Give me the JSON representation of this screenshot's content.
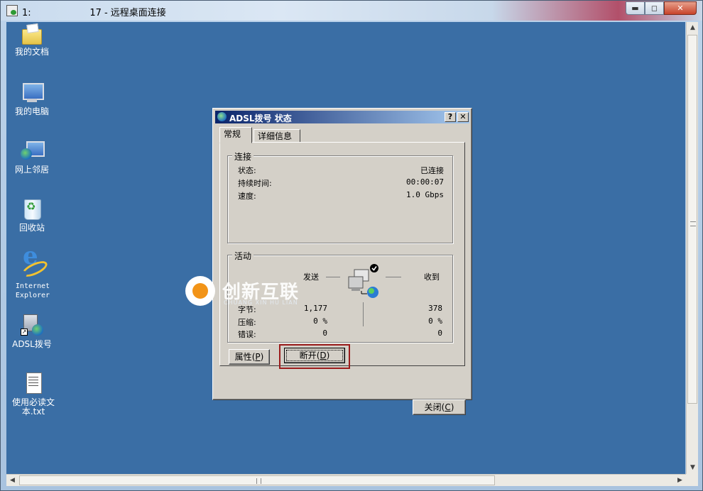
{
  "window": {
    "title_prefix": "1:",
    "title_suffix": "17 - 远程桌面连接",
    "min_label": "▬",
    "max_label": "◻",
    "close_label": "✕"
  },
  "desktop_icons": [
    {
      "name": "my-documents",
      "label": "我的文档",
      "icon": "folder-icon"
    },
    {
      "name": "my-computer",
      "label": "我的电脑",
      "icon": "computer-icon"
    },
    {
      "name": "network-places",
      "label": "网上邻居",
      "icon": "network-icon"
    },
    {
      "name": "recycle-bin",
      "label": "回收站",
      "icon": "recycle-bin-icon"
    },
    {
      "name": "internet-explorer",
      "label": "Internet Explorer",
      "icon": "ie-icon"
    },
    {
      "name": "adsl-dialup",
      "label": "ADSL拨号",
      "icon": "adsl-icon"
    },
    {
      "name": "readme",
      "label": "使用必读文本.txt",
      "icon": "text-file-icon"
    }
  ],
  "dialog": {
    "title": "ADSL拨号 状态",
    "help_label": "?",
    "close_label": "✕",
    "tabs": [
      {
        "label": "常规",
        "active": true
      },
      {
        "label": "详细信息",
        "active": false
      }
    ],
    "connection": {
      "group_title": "连接",
      "status_label": "状态:",
      "status_value": "已连接",
      "duration_label": "持续时间:",
      "duration_value": "00:00:07",
      "speed_label": "速度:",
      "speed_value": "1.0 Gbps"
    },
    "activity": {
      "group_title": "活动",
      "sent_label": "发送",
      "received_label": "收到",
      "bytes_label": "字节:",
      "bytes_sent": "1,177",
      "bytes_received": "378",
      "compression_label": "压缩:",
      "compression_sent": "0 %",
      "compression_received": "0 %",
      "errors_label": "错误:",
      "errors_sent": "0",
      "errors_received": "0"
    },
    "properties_button": "属性",
    "properties_key": "P",
    "disconnect_button": "断开",
    "disconnect_key": "D",
    "close_button": "关闭",
    "close_key": "C"
  },
  "watermark": {
    "name": "创新互联",
    "sub": "CHUANG XIN HU LIAN"
  }
}
